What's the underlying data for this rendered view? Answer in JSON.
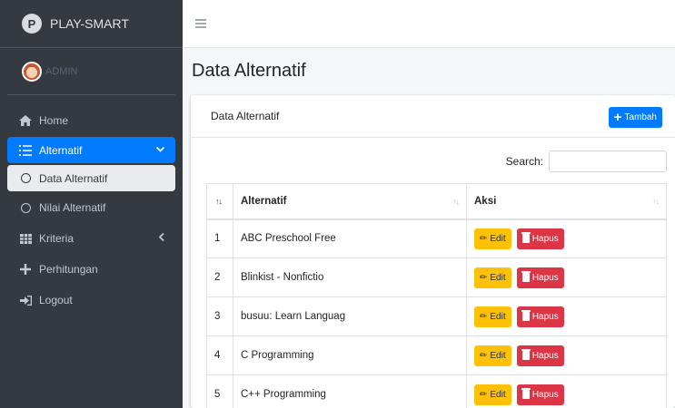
{
  "brand": {
    "logo_letter": "P",
    "name": "PLAY-SMART"
  },
  "user": {
    "name": "ADMIN"
  },
  "sidebar": {
    "items": [
      {
        "label": "Home",
        "icon": "home-icon"
      },
      {
        "label": "Alternatif",
        "icon": "list-icon"
      },
      {
        "label": "Data Alternatif",
        "icon": "circle-icon"
      },
      {
        "label": "Nilai Alternatif",
        "icon": "circle-icon"
      },
      {
        "label": "Kriteria",
        "icon": "table-icon"
      },
      {
        "label": "Perhitungan",
        "icon": "plus-icon"
      },
      {
        "label": "Logout",
        "icon": "sign-out-icon"
      }
    ]
  },
  "header": {
    "menu_icon": "hamburger-icon"
  },
  "page": {
    "title": "Data Alternatif"
  },
  "card": {
    "title": "Data Alternatif",
    "add_label": "Tambah",
    "search_label": "Search:",
    "search_value": ""
  },
  "table": {
    "columns": [
      "",
      "Alternatif",
      "Aksi"
    ],
    "edit_label": "Edit",
    "delete_label": "Hapus",
    "rows": [
      {
        "no": "1",
        "name": "ABC Preschool Free"
      },
      {
        "no": "2",
        "name": "Blinkist - Nonfictio"
      },
      {
        "no": "3",
        "name": "busuu: Learn Languag"
      },
      {
        "no": "4",
        "name": "C Programming"
      },
      {
        "no": "5",
        "name": "C++ Programming"
      }
    ]
  },
  "colors": {
    "sidebar_bg": "#343a40",
    "primary": "#007bff",
    "warning": "#ffc107",
    "danger": "#dc3545"
  }
}
